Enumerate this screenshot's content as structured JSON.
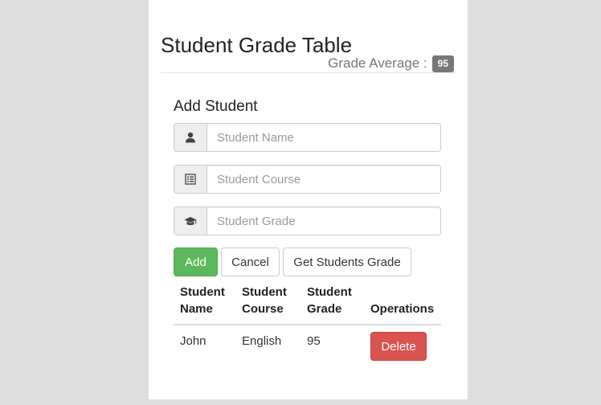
{
  "header": {
    "title": "Student Grade Table",
    "average_label": "Grade Average :",
    "average_value": "95"
  },
  "form": {
    "title": "Add Student",
    "fields": [
      {
        "icon": "user-icon",
        "placeholder": "Student Name",
        "value": ""
      },
      {
        "icon": "list-icon",
        "placeholder": "Student Course",
        "value": ""
      },
      {
        "icon": "graduation-cap-icon",
        "placeholder": "Student Grade",
        "value": ""
      }
    ],
    "buttons": {
      "add": "Add",
      "cancel": "Cancel",
      "get_grades": "Get Students Grade"
    }
  },
  "table": {
    "headers": {
      "name_line1": "Student",
      "name_line2": "Name",
      "course_line1": "Student",
      "course_line2": "Course",
      "grade_line1": "Student",
      "grade_line2": "Grade",
      "operations": "Operations"
    },
    "rows": [
      {
        "name": "John",
        "course": "English",
        "grade": "95",
        "action": "Delete"
      }
    ]
  },
  "colors": {
    "add_button": "#5cb85c",
    "delete_button": "#d9534f",
    "badge": "#777777",
    "background": "#dedede"
  }
}
